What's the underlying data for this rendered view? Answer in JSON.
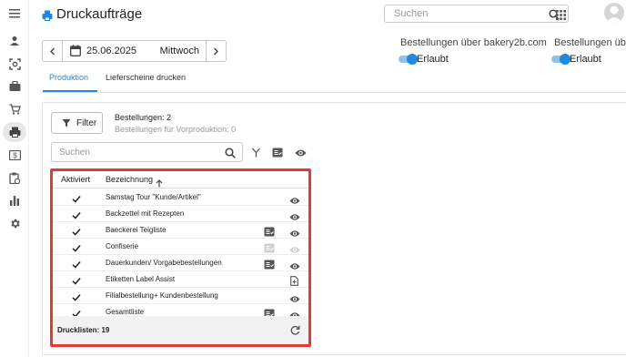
{
  "app": {
    "title": "Druckaufträge"
  },
  "search": {
    "placeholder": "Suchen"
  },
  "date": {
    "value": "25.06.2025",
    "weekday": "Mittwoch"
  },
  "orders": [
    {
      "label": "Bestellungen über bakery2b.com",
      "toggle_label": "Erlaubt",
      "enabled": true
    },
    {
      "label": "Bestellungen über",
      "toggle_label": "Erlaubt",
      "enabled": true
    }
  ],
  "tabs": [
    {
      "label": "Produktion",
      "active": true
    },
    {
      "label": "Lieferscheine drucken",
      "active": false
    }
  ],
  "filter": {
    "label": "Filter",
    "orders_count": "Bestellungen: 2",
    "preproduction_count": "Bestellungen für Vorproduktion: 0"
  },
  "list_search": {
    "placeholder": "Suchen"
  },
  "table": {
    "columns": {
      "active": "Aktiviert",
      "name": "Bezeichnung"
    },
    "rows": [
      {
        "name": "Samstag Tour \"Kunde/Artikel\"",
        "report": false,
        "eye": "active"
      },
      {
        "name": "Backzettel mit Rezepten",
        "report": false,
        "eye": "active"
      },
      {
        "name": "Baeckerei Teigliste",
        "report": "active",
        "eye": "active"
      },
      {
        "name": "Confiserie",
        "report": "disabled",
        "eye": "disabled"
      },
      {
        "name": "Dauerkunden/ Vorgabebestellungen",
        "report": "active",
        "eye": "active"
      },
      {
        "name": "Etiketten Label Assist",
        "report": false,
        "eye": "document"
      },
      {
        "name": "Filialbestellung+ Kundenbestellung",
        "report": false,
        "eye": "active"
      },
      {
        "name": "Gesamtliste",
        "report": "active",
        "eye": "active"
      }
    ],
    "footer": "Drucklisten: 19"
  },
  "colors": {
    "accent": "#1e88e5",
    "highlight": "#e53935"
  },
  "icons": [
    "menu-icon",
    "user-icon",
    "scan-icon",
    "briefcase-icon",
    "cart-icon",
    "printer-icon",
    "cash-icon",
    "clipboard-icon",
    "chart-icon",
    "gear-icon",
    "search-icon",
    "apps-icon",
    "calendar-icon",
    "filter-icon",
    "merge-icon",
    "report-icon",
    "eye-icon",
    "refresh-icon",
    "check-icon",
    "sort-asc-icon"
  ]
}
